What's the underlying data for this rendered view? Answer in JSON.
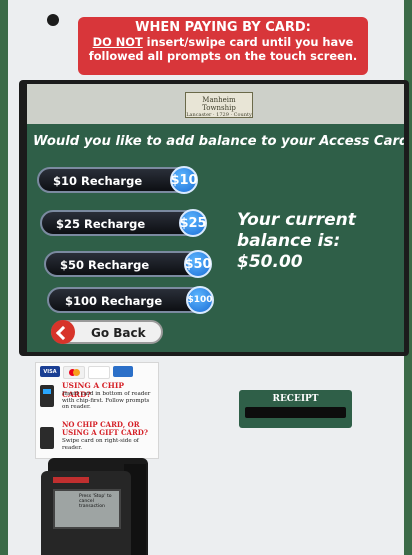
{
  "warning": {
    "line1": "WHEN PAYING BY CARD:",
    "line2_emph": "DO NOT",
    "line2_rest": " insert/swipe card until you have",
    "line3": "followed all prompts on the touch screen."
  },
  "screen": {
    "logo": {
      "name": "Manheim Township",
      "subtitle": "Lancaster · 1729 · County"
    },
    "question": "Would you like to add balance to your Access Card?",
    "options": [
      {
        "label": "$10 Recharge",
        "badge": "$10"
      },
      {
        "label": "$25 Recharge",
        "badge": "$25"
      },
      {
        "label": "$50 Recharge",
        "badge": "$50"
      },
      {
        "label": "$100 Recharge",
        "badge": "$100"
      }
    ],
    "balance_line1": "Your current",
    "balance_line2": "balance is:",
    "balance_value": "$50.00",
    "back_label": "Go Back"
  },
  "decal": {
    "cards": [
      "VISA",
      "MC",
      "DISCOVER",
      "AMEX"
    ],
    "chip_title": "USING A CHIP CARD?",
    "chip_text": "Insert card in bottom of reader with chip-first. Follow prompts on reader.",
    "swipe_title_1": "NO CHIP CARD, OR",
    "swipe_title_2": "USING A GIFT CARD?",
    "swipe_text": "Swipe card on right-side of reader."
  },
  "receipt": {
    "label": "RECEIPT"
  },
  "pinpad": {
    "message": "Press 'Stop' to cancel transaction"
  },
  "colors": {
    "screen_bg": "#2f5f48",
    "warning_bg": "#d8363a",
    "badge_blue": "#1c6ed6"
  }
}
